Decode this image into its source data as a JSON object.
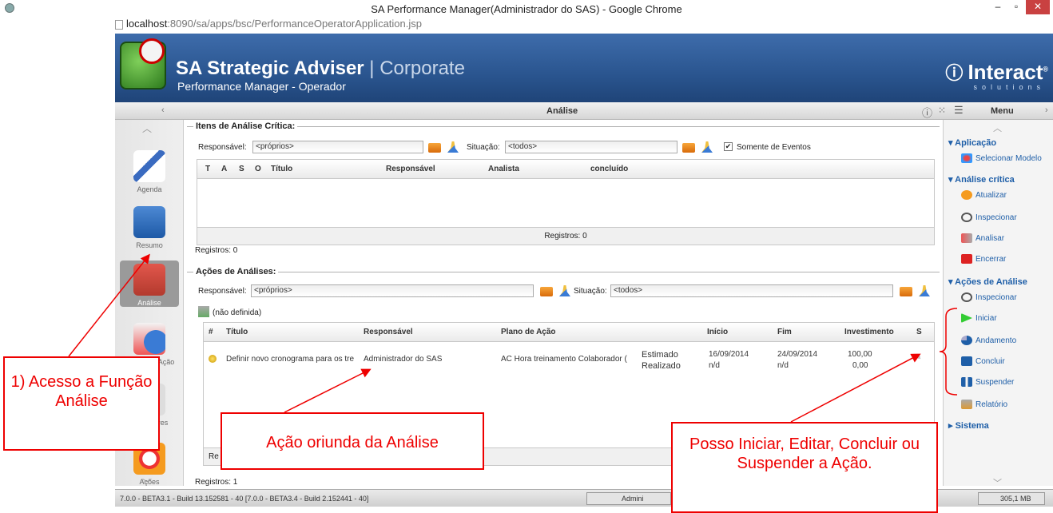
{
  "window": {
    "title": "SA Performance Manager(Administrador do SAS) - Google Chrome",
    "minimize": "–",
    "restore": "▫",
    "close": "✕"
  },
  "url": {
    "host": "localhost",
    "path": ":8090/sa/apps/bsc/PerformanceOperatorApplication.jsp"
  },
  "brand": {
    "title": "SA Strategic Adviser",
    "separator": " | ",
    "edition": "Corporate",
    "subtitle": "Performance Manager - Operador",
    "partner": "Interact",
    "partner_mark": "®",
    "partner_sub": "solutions"
  },
  "header": {
    "title": "Análise",
    "menu": "Menu"
  },
  "left_nav": [
    {
      "label": "Agenda"
    },
    {
      "label": "Resumo"
    },
    {
      "label": "Análise"
    },
    {
      "label": "Planos de Ação"
    },
    {
      "label": "Indicadores"
    },
    {
      "label": "Ações"
    }
  ],
  "critical": {
    "legend": "Itens de Análise Crítica:",
    "resp_label": "Responsável:",
    "resp_value": "<próprios>",
    "sit_label": "Situação:",
    "sit_value": "<todos>",
    "only_events": "Somente de Eventos",
    "columns": [
      "T",
      "A",
      "S",
      "O",
      "Título",
      "Responsável",
      "Analista",
      "concluído"
    ],
    "footer": "Registros: 0",
    "registros": "Registros: 0"
  },
  "actions": {
    "legend": "Ações de Análises:",
    "resp_label": "Responsável:",
    "resp_value": "<próprios>",
    "sit_label": "Situação:",
    "sit_value": "<todos>",
    "group": "(não definida)",
    "columns": [
      "#",
      "Título",
      "Responsável",
      "Plano de Ação",
      "Início",
      "Fim",
      "Investimento",
      "S"
    ],
    "row": {
      "title": "Definir novo cronograma para os tre",
      "responsavel": "Administrador do SAS",
      "plano": "AC Hora treinamento Colaborador (",
      "estimado": "Estimado",
      "realizado": "Realizado",
      "inicio_est": "16/09/2014",
      "inicio_real": "n/d",
      "fim_est": "24/09/2014",
      "fim_real": "n/d",
      "inv_est": "100,00",
      "inv_real": "0,00"
    },
    "footer_fragment": "Re",
    "registros": "Registros: 1"
  },
  "right_menu": {
    "aplicacao": "Aplicação",
    "selecionar_modelo": "Selecionar Modelo",
    "analise_critica": "Análise crítica",
    "atualizar": "Atualizar",
    "inspecionar1": "Inspecionar",
    "analisar": "Analisar",
    "encerrar": "Encerrar",
    "acoes_analise": "Ações de Análise",
    "inspecionar2": "Inspecionar",
    "iniciar": "Iniciar",
    "andamento": "Andamento",
    "concluir": "Concluir",
    "suspender": "Suspender",
    "relatorio": "Relatório",
    "sistema": "Sistema"
  },
  "status": {
    "build": "7.0.0 - BETA3.1 - Build 13.152581 - 40 [7.0.0 - BETA3.4 - Build 2.152441 - 40]",
    "user": "Admini",
    "memory": "305,1 MB"
  },
  "callouts": {
    "c1": "1) Acesso a Função Análise",
    "c2": "Ação oriunda da Análise",
    "c3": "Posso Iniciar, Editar, Concluir ou Suspender a Ação."
  },
  "colors": {
    "accent": "#1f5fa8",
    "callout": "#e00000",
    "banner": "#2a558f"
  }
}
